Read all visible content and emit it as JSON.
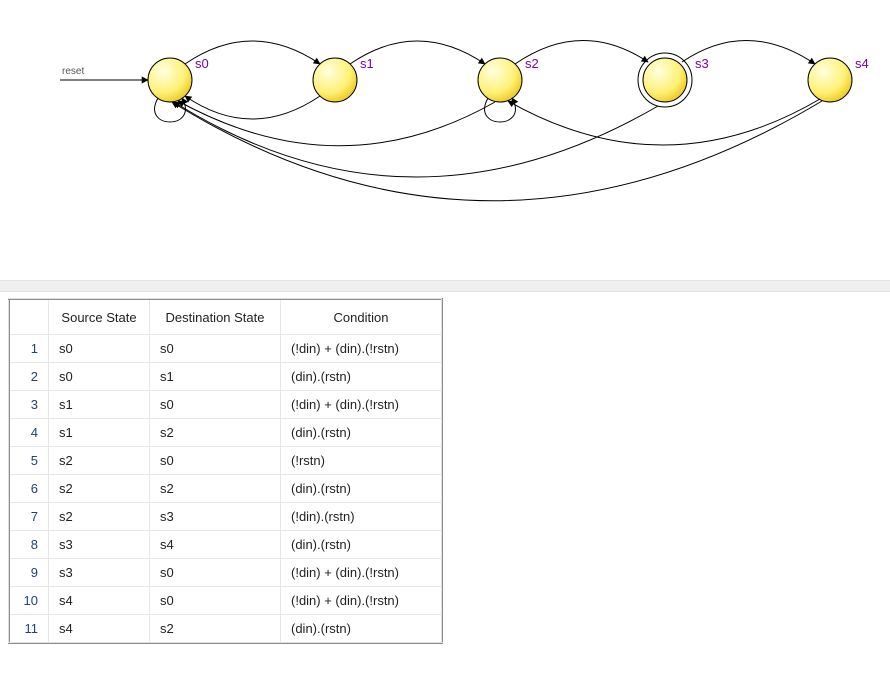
{
  "diagram": {
    "reset_label": "reset",
    "states": [
      {
        "id": "s0",
        "label": "s0",
        "accepting": false
      },
      {
        "id": "s1",
        "label": "s1",
        "accepting": false
      },
      {
        "id": "s2",
        "label": "s2",
        "accepting": false
      },
      {
        "id": "s3",
        "label": "s3",
        "accepting": true
      },
      {
        "id": "s4",
        "label": "s4",
        "accepting": false
      }
    ],
    "transitions": [
      {
        "from": "s0",
        "to": "s0",
        "type": "self"
      },
      {
        "from": "s0",
        "to": "s1",
        "type": "forward"
      },
      {
        "from": "s1",
        "to": "s0",
        "type": "back"
      },
      {
        "from": "s1",
        "to": "s2",
        "type": "forward"
      },
      {
        "from": "s2",
        "to": "s2",
        "type": "self"
      },
      {
        "from": "s2",
        "to": "s3",
        "type": "forward"
      },
      {
        "from": "s3",
        "to": "s4",
        "type": "forward"
      },
      {
        "from": "s2",
        "to": "s0",
        "type": "longback"
      },
      {
        "from": "s3",
        "to": "s0",
        "type": "longback"
      },
      {
        "from": "s4",
        "to": "s0",
        "type": "longback"
      },
      {
        "from": "s4",
        "to": "s2",
        "type": "longback2"
      }
    ]
  },
  "table": {
    "headers": {
      "source": "Source State",
      "destination": "Destination State",
      "condition": "Condition"
    },
    "rows": [
      {
        "n": "1",
        "src": "s0",
        "dst": "s0",
        "cond": "(!din) + (din).(!rstn)"
      },
      {
        "n": "2",
        "src": "s0",
        "dst": "s1",
        "cond": "(din).(rstn)"
      },
      {
        "n": "3",
        "src": "s1",
        "dst": "s0",
        "cond": "(!din) + (din).(!rstn)"
      },
      {
        "n": "4",
        "src": "s1",
        "dst": "s2",
        "cond": "(din).(rstn)"
      },
      {
        "n": "5",
        "src": "s2",
        "dst": "s0",
        "cond": "(!rstn)"
      },
      {
        "n": "6",
        "src": "s2",
        "dst": "s2",
        "cond": "(din).(rstn)"
      },
      {
        "n": "7",
        "src": "s2",
        "dst": "s3",
        "cond": "(!din).(rstn)"
      },
      {
        "n": "8",
        "src": "s3",
        "dst": "s4",
        "cond": "(din).(rstn)"
      },
      {
        "n": "9",
        "src": "s3",
        "dst": "s0",
        "cond": "(!din) + (din).(!rstn)"
      },
      {
        "n": "10",
        "src": "s4",
        "dst": "s0",
        "cond": "(!din) + (din).(!rstn)"
      },
      {
        "n": "11",
        "src": "s4",
        "dst": "s2",
        "cond": "(din).(rstn)"
      }
    ]
  }
}
